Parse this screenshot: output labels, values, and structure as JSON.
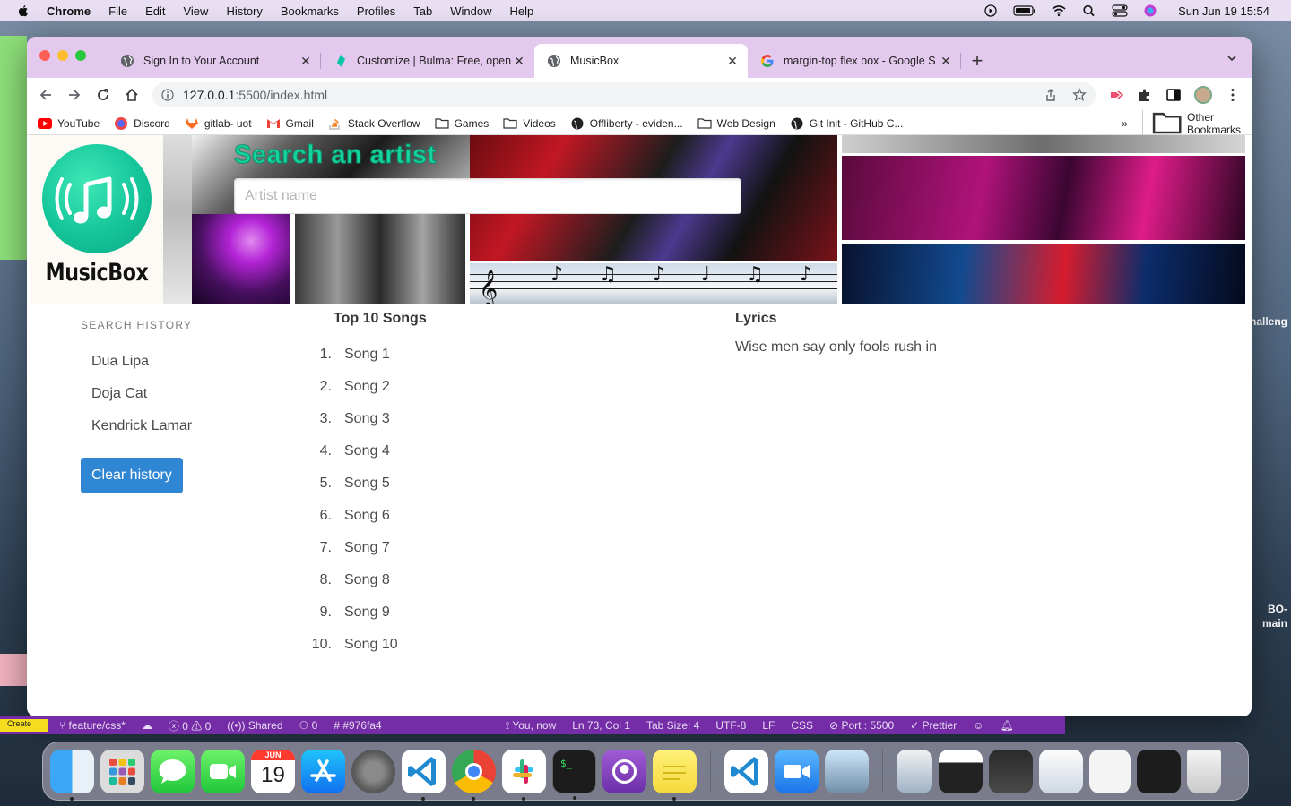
{
  "menubar": {
    "app": "Chrome",
    "items": [
      "File",
      "Edit",
      "View",
      "History",
      "Bookmarks",
      "Profiles",
      "Tab",
      "Window",
      "Help"
    ],
    "clock": "Sun Jun 19  15:54"
  },
  "browser": {
    "tabs": [
      {
        "title": "Sign In to Your Account",
        "icon": "globe-icon"
      },
      {
        "title": "Customize | Bulma: Free, open",
        "icon": "bulma-icon"
      },
      {
        "title": "MusicBox",
        "icon": "globe-icon",
        "active": true
      },
      {
        "title": "margin-top flex box - Google S",
        "icon": "google-icon"
      }
    ],
    "url": {
      "host": "127.0.0.1",
      "rest": ":5500/index.html"
    },
    "bookmarks": [
      {
        "label": "YouTube",
        "icon": "youtube-icon"
      },
      {
        "label": "Discord",
        "icon": "discord-icon"
      },
      {
        "label": "gitlab- uot",
        "icon": "gitlab-icon"
      },
      {
        "label": "Gmail",
        "icon": "gmail-icon"
      },
      {
        "label": "Stack Overflow",
        "icon": "stackoverflow-icon"
      },
      {
        "label": "Games",
        "icon": "folder-icon"
      },
      {
        "label": "Videos",
        "icon": "folder-icon"
      },
      {
        "label": "Offliberty - eviden...",
        "icon": "globe-icon"
      },
      {
        "label": "Web Design",
        "icon": "folder-icon"
      },
      {
        "label": "Git Init - GitHub C...",
        "icon": "globe-icon"
      }
    ],
    "other_bookmarks": "Other Bookmarks",
    "more_chevron": "»"
  },
  "page": {
    "logo_text": "MusicBox",
    "search_title": "Search an artist",
    "search_placeholder": "Artist name",
    "history": {
      "label": "Search History",
      "items": [
        "Dua Lipa",
        "Doja Cat",
        "Kendrick Lamar"
      ],
      "clear_label": "Clear history"
    },
    "songs": {
      "title": "Top 10 Songs",
      "items": [
        "Song 1",
        "Song 2",
        "Song 3",
        "Song 4",
        "Song 5",
        "Song 6",
        "Song 7",
        "Song 8",
        "Song 9",
        "Song 10"
      ]
    },
    "lyrics": {
      "title": "Lyrics",
      "text": "Wise men say only fools rush in"
    }
  },
  "statusbar": {
    "create": "Create",
    "branch": "feature/css*",
    "problems": "0 ⚠ 0",
    "shared": "Shared",
    "participants": "0",
    "commit": "#976fa4",
    "blame": "You, now",
    "position": "Ln 73, Col 1",
    "tabsize": "Tab Size: 4",
    "encoding": "UTF-8",
    "eol": "LF",
    "lang": "CSS",
    "port": "Port : 5500",
    "prettier": "Prettier"
  },
  "desktop_text": {
    "right_1": "halleng",
    "right_2": "BO-",
    "right_3": "main"
  },
  "calendar_tile": {
    "month": "JUN",
    "day": "19"
  }
}
